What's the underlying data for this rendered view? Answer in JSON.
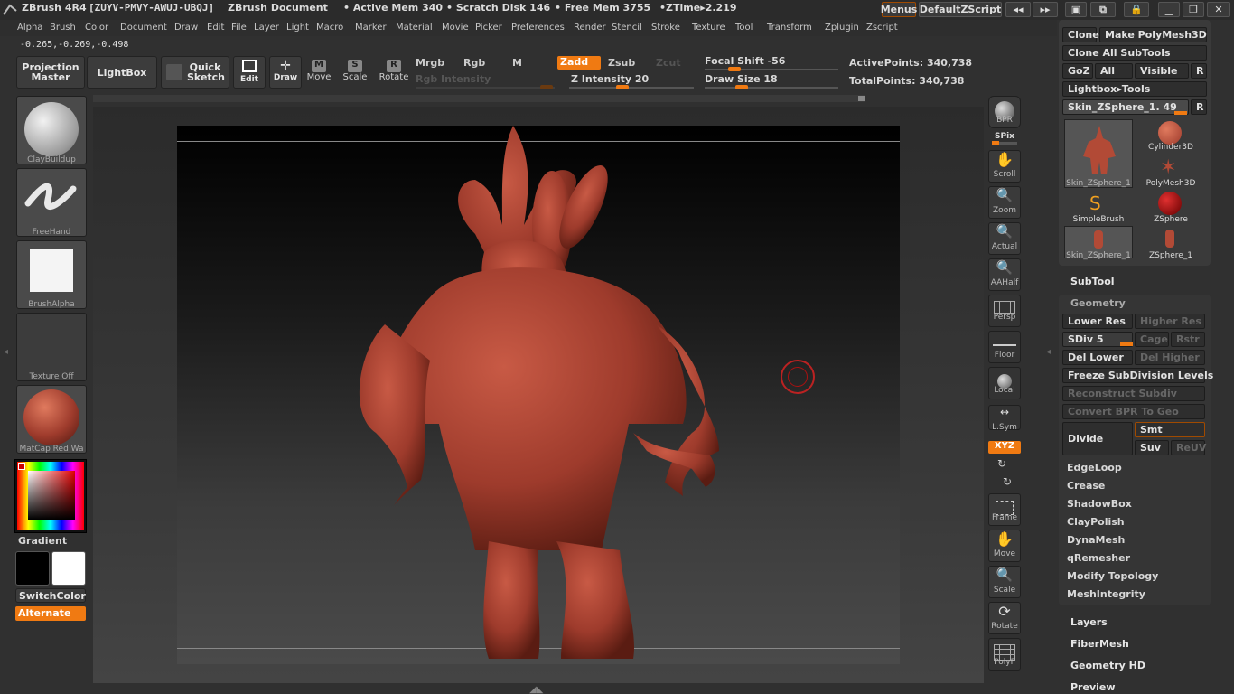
{
  "titlebar": {
    "app": "ZBrush 4R4",
    "serial": "[ZUYV-PMVY-AWUJ-UBQJ]",
    "doc": "ZBrush Document",
    "active_mem": "• Active Mem 340",
    "scratch": "• Scratch Disk 146",
    "free_mem": "• Free Mem 3755",
    "ztime": "•ZTime▸2.219",
    "menus": "Menus",
    "zscript": "DefaultZScript"
  },
  "menubar": [
    "Alpha",
    "Brush",
    "Color",
    "Document",
    "Draw",
    "Edit",
    "File",
    "Layer",
    "Light",
    "Macro",
    "Marker",
    "Material",
    "Movie",
    "Picker",
    "Preferences",
    "Render",
    "Stencil",
    "Stroke",
    "Texture",
    "Tool",
    "Transform",
    "Zplugin",
    "Zscript"
  ],
  "coords": "-0.265,-0.269,-0.498",
  "toolbar": {
    "projection_master": "Projection Master",
    "lightbox": "LightBox",
    "quick_sketch": "Quick Sketch",
    "edit": "Edit",
    "draw": "Draw",
    "move": "Move",
    "scale": "Scale",
    "rotate": "Rotate",
    "mrgb": "Mrgb",
    "rgb": "Rgb",
    "m": "M",
    "zadd": "Zadd",
    "zsub": "Zsub",
    "zcut": "Zcut",
    "rgb_intensity": "Rgb Intensity",
    "z_intensity": "Z Intensity 20",
    "focal_shift": "Focal Shift -56",
    "draw_size": "Draw Size 18",
    "active_points": "ActivePoints: 340,738",
    "total_points": "TotalPoints: 340,738"
  },
  "left_shelf": {
    "brush": "ClayBuildup",
    "stroke": "FreeHand",
    "alpha": "BrushAlpha",
    "texture": "Texture Off",
    "material": "MatCap Red Wa",
    "gradient": "Gradient",
    "switch_color": "SwitchColor",
    "alternate": "Alternate"
  },
  "right_shelf": [
    "BPR",
    "SPix",
    "Scroll",
    "Zoom",
    "Actual",
    "AAHalf",
    "Persp",
    "Floor",
    "Local",
    "L.Sym",
    "XYZ",
    "Frame",
    "Move",
    "Scale",
    "Rotate",
    "PolyF"
  ],
  "palette": {
    "clone": "Clone",
    "make_polymesh": "Make PolyMesh3D",
    "clone_all": "Clone All SubTools",
    "goz": "GoZ",
    "all": "All",
    "visible": "Visible",
    "r": "R",
    "lightbox_tools": "Lightbox▸Tools",
    "current_tool": "Skin_ZSphere_1. 49",
    "tiles": [
      "Skin_ZSphere_1",
      "Cylinder3D",
      "PolyMesh3D",
      "SimpleBrush",
      "ZSphere",
      "Skin_ZSphere_1",
      "ZSphere_1"
    ]
  },
  "subtool": "SubTool",
  "geometry": {
    "title": "Geometry",
    "lower_res": "Lower Res",
    "higher_res": "Higher Res",
    "sdiv": "SDiv 5",
    "cage": "Cage",
    "rstr": "Rstr",
    "del_lower": "Del Lower",
    "del_higher": "Del Higher",
    "freeze": "Freeze SubDivision Levels",
    "reconstruct": "Reconstruct Subdiv",
    "convert_bpr": "Convert BPR To Geo",
    "divide": "Divide",
    "smt": "Smt",
    "suv": "Suv",
    "reuv": "ReUV",
    "items": [
      "EdgeLoop",
      "Crease",
      "ShadowBox",
      "ClayPolish",
      "DynaMesh",
      "qRemesher",
      "Modify Topology",
      "MeshIntegrity"
    ]
  },
  "more": [
    "Layers",
    "FiberMesh",
    "Geometry HD",
    "Preview"
  ],
  "colors": {
    "accent": "#f07a12",
    "model": "#9e3b2c"
  },
  "sliders": {
    "focal_shift": -56,
    "draw_size": 18,
    "z_intensity": 20
  }
}
